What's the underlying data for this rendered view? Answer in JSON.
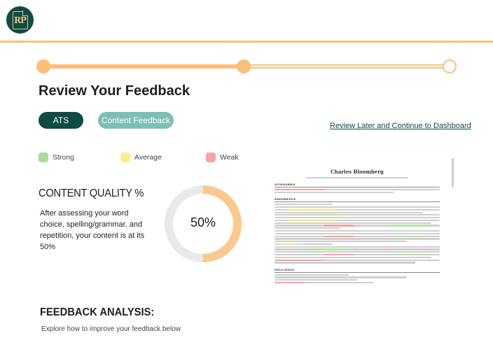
{
  "logo": {
    "text": "RP"
  },
  "progress": {
    "steps": [
      {
        "state": "complete"
      },
      {
        "state": "complete"
      },
      {
        "state": "incomplete"
      }
    ]
  },
  "page": {
    "title": "Review Your Feedback"
  },
  "tabs": [
    {
      "label": "ATS",
      "active": true
    },
    {
      "label": "Content Feedback",
      "active": false
    }
  ],
  "actions": {
    "later_link": "Review Later and Continue to Dashboard"
  },
  "legend": [
    {
      "label": "Strong",
      "color": "#a9dc98"
    },
    {
      "label": "Average",
      "color": "#f9ee8c"
    },
    {
      "label": "Weak",
      "color": "#f4a3a3"
    }
  ],
  "content_quality": {
    "title": "CONTENT QUALITY %",
    "description": "After assessing your word choice, spelling/grammar, and repetition, your content is at its 50%",
    "percent_label": "50%",
    "percent": 50,
    "fill_color": "#fbc98b",
    "track_color": "#e9e9e9"
  },
  "feedback_analysis": {
    "title": "FEEDBACK ANALYSIS:",
    "description": "Explore how to improve your feedback below"
  },
  "resume": {
    "name": "Charles Bloomberg",
    "sections": [
      "SUMMARIES",
      "EXPERIENCE",
      "EDUCATION"
    ]
  },
  "colors": {
    "brand": "#0e4b45",
    "accent": "#fbbf7a",
    "secondary": "#7bbfb5"
  }
}
